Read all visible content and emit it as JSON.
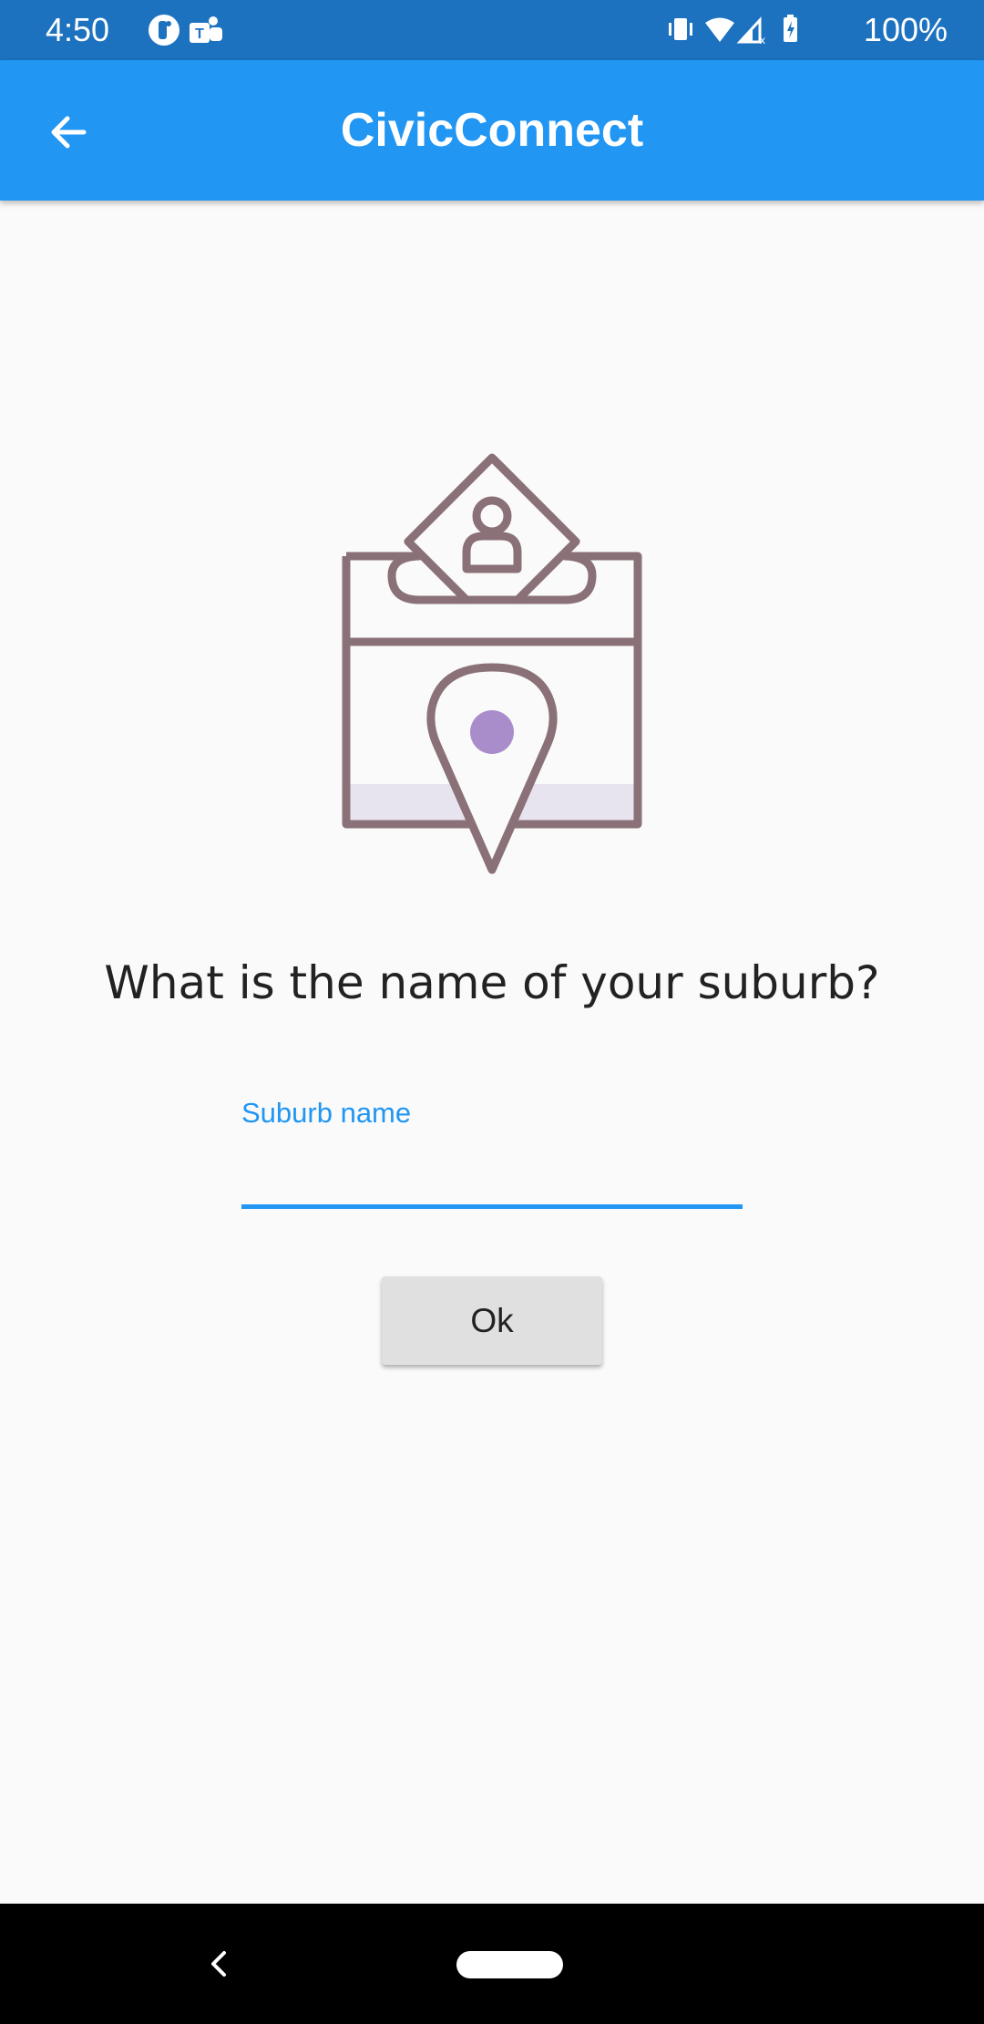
{
  "status_bar": {
    "time": "4:50",
    "battery": "100%",
    "icons": [
      "notification-icon",
      "teams-icon",
      "vibrate-icon",
      "wifi-icon",
      "cell-signal-icon",
      "battery-icon"
    ]
  },
  "app_bar": {
    "back_icon": "arrow-back-icon",
    "title": "CivicConnect"
  },
  "illustration": {
    "name": "ballot-box-location-illustration",
    "stroke_color": "#8a7177",
    "accent_color": "#a98dcb",
    "fill_color": "#e8e4ef"
  },
  "content": {
    "question": "What is the name of your suburb?",
    "suburb_field": {
      "label": "Suburb name",
      "value": ""
    },
    "ok_label": "Ok"
  },
  "colors": {
    "status_bar": "#1c72bf",
    "app_bar": "#2196f3",
    "accent": "#2196f3",
    "background": "#fafafa"
  },
  "nav_bar": {
    "back_icon": "nav-back-icon",
    "home_icon": "nav-home-pill"
  }
}
